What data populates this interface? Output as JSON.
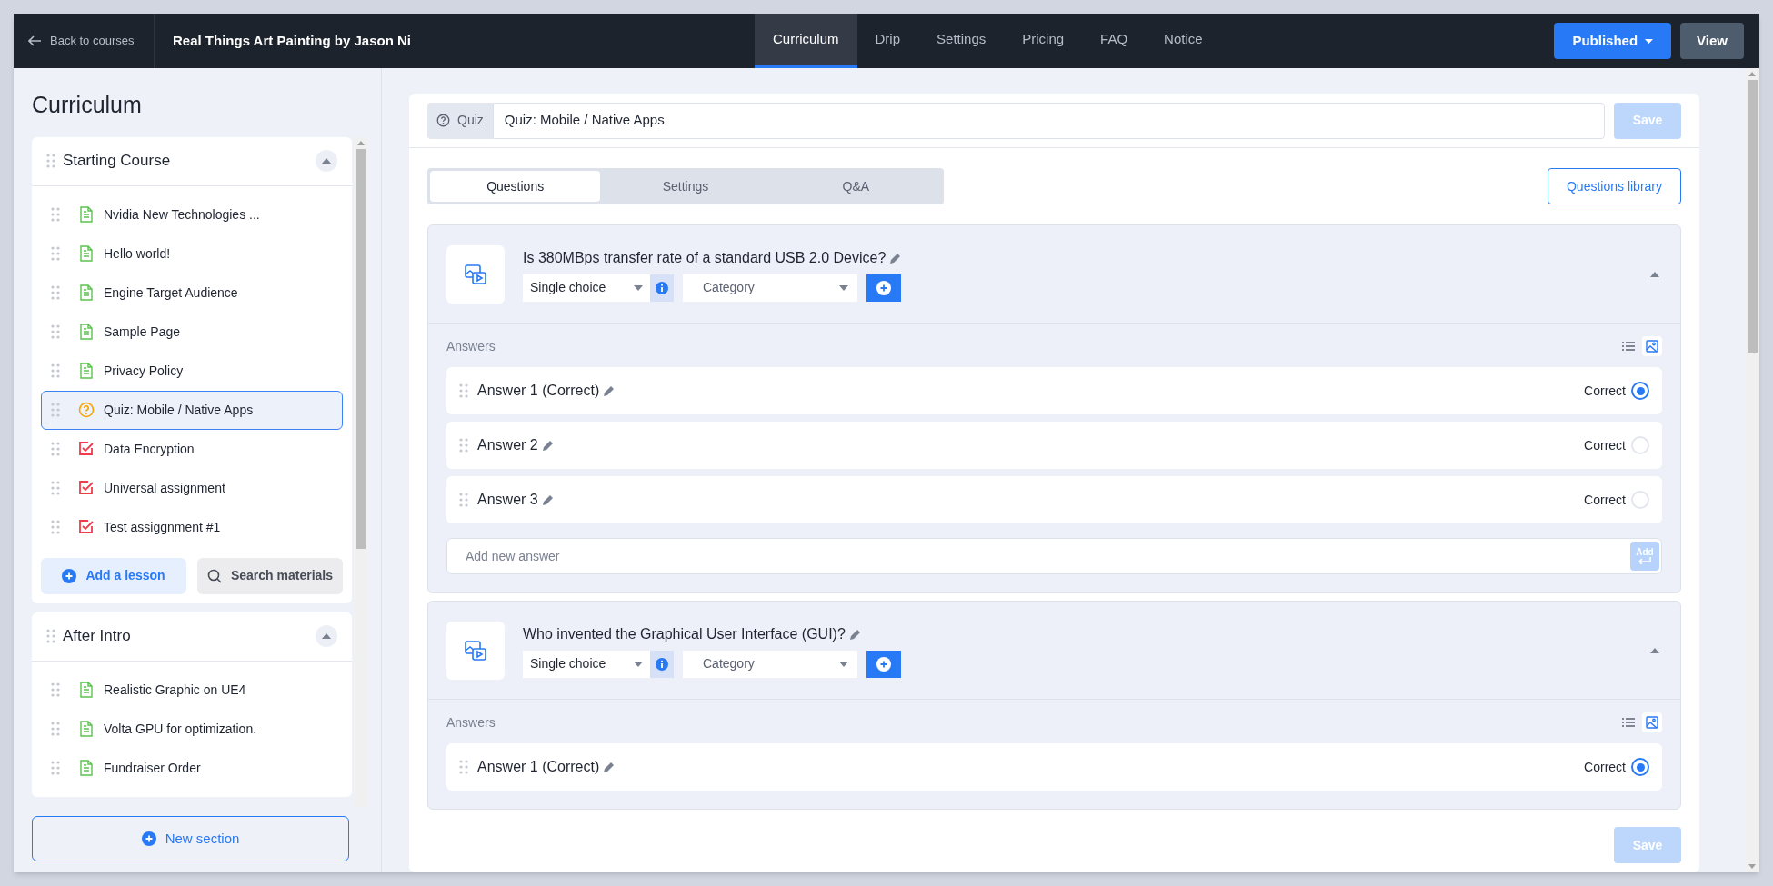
{
  "header": {
    "back": "Back to courses",
    "course_title": "Real Things Art Painting by Jason Ni",
    "tabs": [
      {
        "label": "Curriculum",
        "selected": true
      },
      {
        "label": "Drip",
        "selected": false
      },
      {
        "label": "Settings",
        "selected": false
      },
      {
        "label": "Pricing",
        "selected": false
      },
      {
        "label": "FAQ",
        "selected": false
      },
      {
        "label": "Notice",
        "selected": false
      }
    ],
    "publish_button": "Published",
    "view_button": "View"
  },
  "sidebar": {
    "title": "Curriculum",
    "sections": [
      {
        "title": "Starting Course",
        "expanded": true,
        "lessons": [
          {
            "kind": "text",
            "title": "Nvidia New Technologies ...",
            "selected": false
          },
          {
            "kind": "text",
            "title": "Hello world!",
            "selected": false
          },
          {
            "kind": "text",
            "title": "Engine Target Audience",
            "selected": false
          },
          {
            "kind": "text",
            "title": "Sample Page",
            "selected": false
          },
          {
            "kind": "text",
            "title": "Privacy Policy",
            "selected": false
          },
          {
            "kind": "quiz",
            "title": "Quiz: Mobile / Native Apps",
            "selected": true
          },
          {
            "kind": "assignment",
            "title": "Data Encryption",
            "selected": false
          },
          {
            "kind": "assignment",
            "title": "Universal assignment",
            "selected": false
          },
          {
            "kind": "assignment",
            "title": "Test assiggnment #1",
            "selected": false
          }
        ],
        "add_lesson": "Add a lesson",
        "search_materials": "Search materials"
      },
      {
        "title": "After Intro",
        "expanded": true,
        "lessons": [
          {
            "kind": "text",
            "title": "Realistic Graphic on UE4",
            "selected": false
          },
          {
            "kind": "text",
            "title": "Volta GPU for optimization.",
            "selected": false
          },
          {
            "kind": "text",
            "title": "Fundraiser Order",
            "selected": false
          }
        ]
      }
    ],
    "new_section": "New section"
  },
  "editor": {
    "type_label": "Quiz",
    "title_value": "Quiz: Mobile / Native Apps",
    "save_top": "Save",
    "tabs": [
      {
        "label": "Questions",
        "selected": true
      },
      {
        "label": "Settings",
        "selected": false
      },
      {
        "label": "Q&A",
        "selected": false
      }
    ],
    "library_button": "Questions library",
    "questions": [
      {
        "title": "Is 380MBps transfer rate of a standard USB 2.0 Device?",
        "type": "Single choice",
        "category_placeholder": "Category",
        "expanded": true,
        "answers_label": "Answers",
        "image_view": true,
        "answers": [
          {
            "text": "Answer 1 (Correct)",
            "correct_label": "Correct",
            "correct": true
          },
          {
            "text": "Answer 2",
            "correct_label": "Correct",
            "correct": false
          },
          {
            "text": "Answer 3",
            "correct_label": "Correct",
            "correct": false
          }
        ],
        "new_answer_placeholder": "Add new answer",
        "add_button": "Add"
      },
      {
        "title": "Who invented the Graphical User Interface (GUI)?",
        "type": "Single choice",
        "category_placeholder": "Category",
        "expanded": true,
        "answers_label": "Answers",
        "image_view": true,
        "answers": [
          {
            "text": "Answer 1 (Correct)",
            "correct_label": "Correct",
            "correct": true
          }
        ]
      }
    ],
    "save_bottom": "Save"
  }
}
